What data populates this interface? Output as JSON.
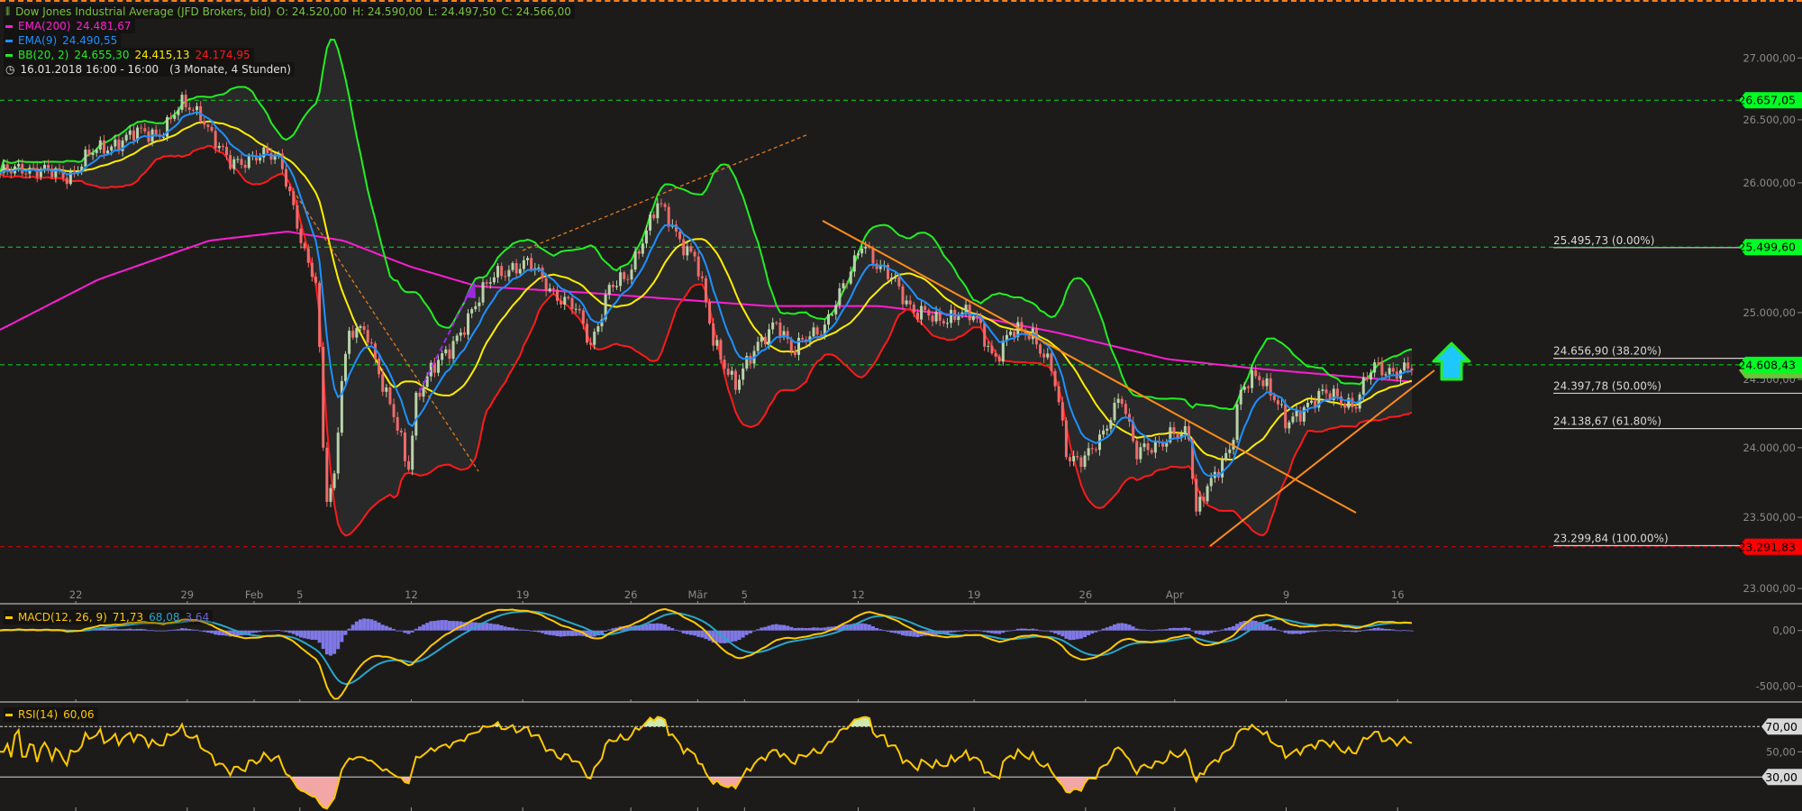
{
  "header": {
    "title": "Dow Jones Industrial Average (JFD Brokers, bid)",
    "open": "O: 24.520,00",
    "high": "H: 24.590,00",
    "low": "L: 24.497,50",
    "close": "C: 24.566,00"
  },
  "legend": {
    "ema200": {
      "label": "EMA(200)",
      "value": "24.481,67",
      "color": "#ff1ed2"
    },
    "ema9": {
      "label": "EMA(9)",
      "value": "24.490,55",
      "color": "#1e90ff"
    },
    "bb": {
      "label": "BB(20, 2)",
      "upper": "24.655,30",
      "middle": "24.415,13",
      "lower": "24.174,95",
      "colors": [
        "#22ee22",
        "#ffee00",
        "#ff1a1a"
      ]
    },
    "period": "16.01.2018 16:00 - 16:00",
    "range": "(3 Monate, 4 Stunden)"
  },
  "macd_legend": {
    "label": "MACD(12, 26, 9)",
    "macd": "71,73",
    "signal": "68,08",
    "hist": "3,64"
  },
  "rsi_legend": {
    "label": "RSI(14)",
    "value": "60,06"
  },
  "chart_data": {
    "type": "candlestick",
    "scale": "log",
    "x_unit": "trading days since 16.01.2018",
    "t": [
      0.6,
      1.6,
      2.7,
      3.7,
      4.7,
      5.8,
      6.8,
      7.8,
      8.8,
      9.6,
      10.4,
      10.9,
      11.9,
      13.2,
      13.7,
      14.3,
      14.8,
      15.2,
      15.6,
      15.9,
      16.3,
      17.1,
      17.6,
      18.4,
      18.9,
      19.3,
      19.9,
      20.7,
      21.7,
      22.8,
      23.5,
      24.3,
      25.3,
      26.4,
      27.1,
      27.9,
      28.7,
      29.5,
      30.1,
      31.0,
      31.8,
      32.6,
      33.6,
      34.4,
      35.4,
      36.2,
      36.9,
      37.7,
      38.5,
      39.3,
      40.0,
      40.8,
      41.6,
      42.6,
      43.6,
      44.4,
      45.2,
      45.9,
      47.0,
      47.8,
      48.5,
      49.3,
      50.1,
      50.9,
      51.6,
      52.4,
      53.2,
      54.0,
      54.2,
      54.7,
      55.3,
      55.8,
      56.3,
      57.0,
      57.6,
      58.3,
      59.1,
      59.9,
      60.7,
      61.4,
      62.2,
      63.0,
      64.0
    ],
    "close": [
      26050,
      26140,
      26070,
      26070,
      26220,
      26330,
      26380,
      26410,
      26610,
      26570,
      26270,
      26140,
      26220,
      26180,
      25880,
      25400,
      25190,
      23630,
      23800,
      24490,
      24840,
      24840,
      24580,
      24150,
      23800,
      24410,
      24580,
      24670,
      25020,
      25270,
      25360,
      25360,
      25190,
      25020,
      24760,
      25190,
      25230,
      25620,
      25830,
      25580,
      25440,
      24760,
      24490,
      24670,
      24970,
      24670,
      24840,
      24930,
      25190,
      25580,
      25320,
      25230,
      25020,
      24930,
      25020,
      24930,
      24670,
      24840,
      24840,
      24580,
      23890,
      23970,
      24060,
      24410,
      23970,
      23970,
      24150,
      24060,
      23460,
      23720,
      23890,
      23970,
      24410,
      24580,
      24410,
      24150,
      24320,
      24370,
      24370,
      24320,
      24580,
      24580,
      24566
    ],
    "ema200": {
      "t": [
        0.6,
        5,
        10,
        13.5,
        16,
        19,
        22,
        27,
        35,
        40,
        45,
        48,
        53,
        57,
        64
      ],
      "v": [
        24870,
        25250,
        25550,
        25620,
        25550,
        25350,
        25200,
        25150,
        25050,
        25050,
        24950,
        24850,
        24650,
        24580,
        24482
      ]
    },
    "x_ticks": [
      {
        "t": 4.0,
        "label": "22"
      },
      {
        "t": 9.0,
        "label": "29"
      },
      {
        "t": 12.0,
        "label": "Feb"
      },
      {
        "t": 14.05,
        "label": "5"
      },
      {
        "t": 19.05,
        "label": "12"
      },
      {
        "t": 24.05,
        "label": "19"
      },
      {
        "t": 28.9,
        "label": "26"
      },
      {
        "t": 31.9,
        "label": "Mär"
      },
      {
        "t": 34.0,
        "label": "5"
      },
      {
        "t": 39.1,
        "label": "12"
      },
      {
        "t": 44.3,
        "label": "19"
      },
      {
        "t": 49.3,
        "label": "26"
      },
      {
        "t": 53.3,
        "label": "Apr"
      },
      {
        "t": 58.3,
        "label": "9"
      },
      {
        "t": 63.3,
        "label": "16"
      }
    ],
    "price_ticks": [
      {
        "v": 27000,
        "label": "27.000,00"
      },
      {
        "v": 26500,
        "label": "26.500,00"
      },
      {
        "v": 26000,
        "label": "26.000,00"
      },
      {
        "v": 25000,
        "label": "25.000,00"
      },
      {
        "v": 24500,
        "label": "24.500,00"
      },
      {
        "v": 24000,
        "label": "24.000,00"
      },
      {
        "v": 23500,
        "label": "23.500,00"
      },
      {
        "v": 23000,
        "label": "23.000,00"
      }
    ],
    "price_markers": [
      {
        "v": 26657.05,
        "label": "26.657,05",
        "color": "#00ff22"
      },
      {
        "v": 25499.6,
        "label": "25.499,60",
        "color": "#00ff22"
      },
      {
        "v": 24608.43,
        "label": "24.608,43",
        "color": "#00ff22"
      },
      {
        "v": 23291.83,
        "label": "23.291,83",
        "color": "#ff0000"
      }
    ],
    "fib_levels": [
      {
        "v": 25495.73,
        "label": "25.495,73 (0.00%)"
      },
      {
        "v": 24656.9,
        "label": "24.656,90 (38.20%)"
      },
      {
        "v": 24397.78,
        "label": "24.397,78 (50.00%)"
      },
      {
        "v": 24138.67,
        "label": "24.138,67 (61.80%)"
      },
      {
        "v": 23299.84,
        "label": "23.299,84 (100.00%)"
      }
    ],
    "macd_ticks": [
      {
        "v": 0,
        "label": "0,00"
      },
      {
        "v": -500,
        "label": "-500,00"
      }
    ],
    "rsi_ticks": [
      {
        "v": 70,
        "label": "70,00",
        "tag": true
      },
      {
        "v": 50,
        "label": "50,00",
        "tag": false
      },
      {
        "v": 30,
        "label": "30,00",
        "tag": true
      }
    ],
    "colors": {
      "up": "#b9d3a9",
      "down": "#ee6b6b",
      "macd": "#ffc800",
      "signal": "#2aa6c8",
      "hist": "#7f78e6",
      "rsi": "#ffc800",
      "bb_fill": "#2b2b2b"
    }
  }
}
